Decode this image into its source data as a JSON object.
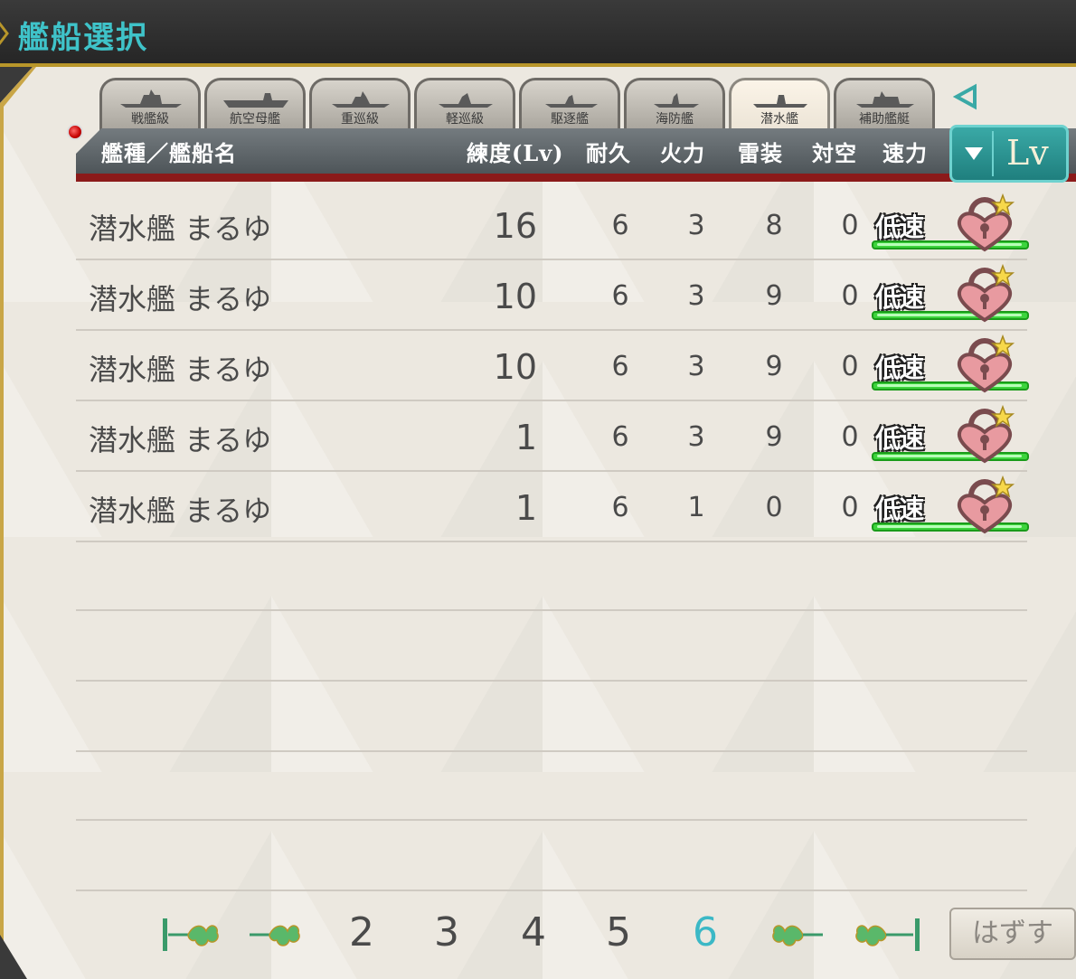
{
  "title": "艦船選択",
  "tabs": [
    {
      "label": "戦艦級",
      "active": false
    },
    {
      "label": "航空母艦",
      "active": false
    },
    {
      "label": "重巡級",
      "active": false
    },
    {
      "label": "軽巡級",
      "active": false
    },
    {
      "label": "駆逐艦",
      "active": false
    },
    {
      "label": "海防艦",
      "active": false
    },
    {
      "label": "潜水艦",
      "active": true
    },
    {
      "label": "補助艦艇",
      "active": false
    }
  ],
  "columns": {
    "name": "艦種／艦船名",
    "level": "練度(Lv)",
    "hp": "耐久",
    "firepower": "火力",
    "torpedo": "雷装",
    "aa": "対空",
    "speed": "速力"
  },
  "sort_button": {
    "label": "Lv"
  },
  "rows": [
    {
      "name": "潜水艦 まるゆ",
      "level": "16",
      "hp": "6",
      "firepower": "3",
      "torpedo": "8",
      "aa": "0",
      "speed": "低速"
    },
    {
      "name": "潜水艦 まるゆ",
      "level": "10",
      "hp": "6",
      "firepower": "3",
      "torpedo": "9",
      "aa": "0",
      "speed": "低速"
    },
    {
      "name": "潜水艦 まるゆ",
      "level": "10",
      "hp": "6",
      "firepower": "3",
      "torpedo": "9",
      "aa": "0",
      "speed": "低速"
    },
    {
      "name": "潜水艦 まるゆ",
      "level": "1",
      "hp": "6",
      "firepower": "3",
      "torpedo": "9",
      "aa": "0",
      "speed": "低速"
    },
    {
      "name": "潜水艦 まるゆ",
      "level": "1",
      "hp": "6",
      "firepower": "1",
      "torpedo": "0",
      "aa": "0",
      "speed": "低速"
    }
  ],
  "pagination": {
    "pages": [
      "2",
      "3",
      "4",
      "5",
      "6"
    ],
    "current": "6"
  },
  "remove_button": {
    "label": "はずす"
  },
  "colors": {
    "accent": "#3fc3c9",
    "header": "#5f666a",
    "header_stripe": "#8b1a1a",
    "status_bar": "#3dd43d",
    "lock": "#e89aa0"
  }
}
